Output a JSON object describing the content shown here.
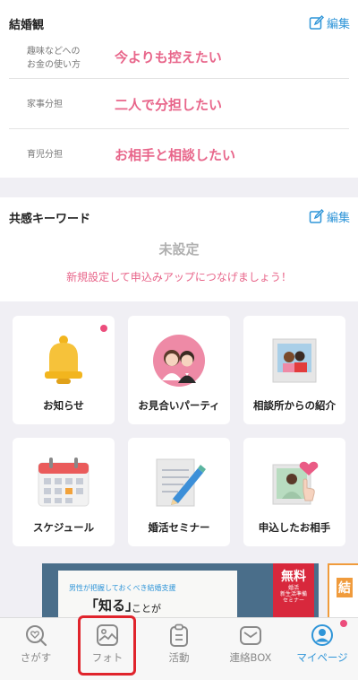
{
  "marriage": {
    "title": "結婚観",
    "edit_label": "編集",
    "rows": [
      {
        "label": "趣味などへの\nお金の使い方",
        "value": "今よりも控えたい"
      },
      {
        "label": "家事分担",
        "value": "二人で分担したい"
      },
      {
        "label": "育児分担",
        "value": "お相手と相談したい"
      }
    ]
  },
  "keywords": {
    "title": "共感キーワード",
    "edit_label": "編集",
    "status": "未設定",
    "hint": "新規設定して申込みアップにつなげましょう！"
  },
  "menu": {
    "tiles": [
      {
        "label": "お知らせ",
        "icon": "bell-icon",
        "has_badge": true
      },
      {
        "label": "お見合いパーティ",
        "icon": "couple-icon",
        "has_badge": false
      },
      {
        "label": "相談所からの紹介",
        "icon": "photo-couple-icon",
        "has_badge": false
      },
      {
        "label": "スケジュール",
        "icon": "calendar-icon",
        "has_badge": false
      },
      {
        "label": "婚活セミナー",
        "icon": "notepad-pencil-icon",
        "has_badge": false
      },
      {
        "label": "申込したお相手",
        "icon": "heart-photo-icon",
        "has_badge": false
      }
    ]
  },
  "banner": {
    "line1": "男性が把握しておくべき結婚支援",
    "big": "「知る」",
    "big2": "ことが",
    "free": "無料",
    "free_sub": "婚活\n新生活準備\nセミナー",
    "side": "結"
  },
  "tabbar": {
    "tabs": [
      {
        "label": "さがす",
        "icon": "search-heart-icon",
        "active": false
      },
      {
        "label": "フォト",
        "icon": "photo-icon",
        "active": false
      },
      {
        "label": "活動",
        "icon": "clipboard-icon",
        "active": false
      },
      {
        "label": "連絡BOX",
        "icon": "mail-icon",
        "active": false
      },
      {
        "label": "マイページ",
        "icon": "user-icon",
        "active": true
      }
    ]
  },
  "colors": {
    "accent": "#2f95d8",
    "pink": "#e8658a",
    "badge": "#ec4d7c",
    "highlight": "#e0242c"
  }
}
